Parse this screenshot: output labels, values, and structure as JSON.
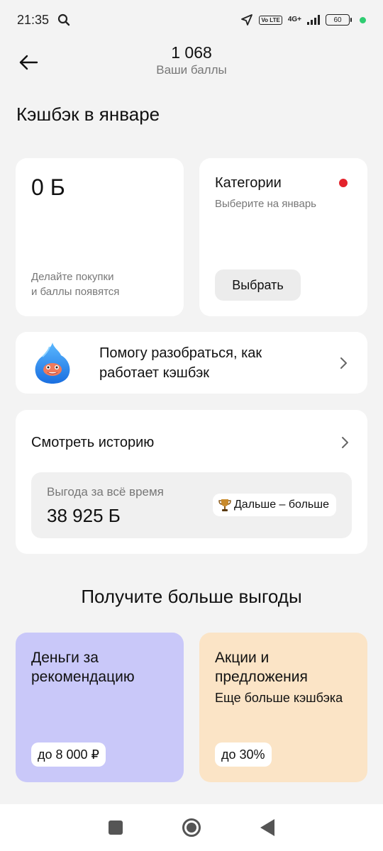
{
  "status_bar": {
    "time": "21:35",
    "volte": "Vo LTE",
    "network": "4G+",
    "battery": "60",
    "icons": [
      "search-icon",
      "location-arrow-icon",
      "signal-icon",
      "battery-icon"
    ]
  },
  "header": {
    "points_value": "1 068",
    "points_label": "Ваши баллы",
    "back_icon": "arrow-left-icon"
  },
  "cashback": {
    "section_title": "Кэшбэк в январе",
    "balance_value": "0 Б",
    "balance_hint_line1": "Делайте покупки",
    "balance_hint_line2": "и баллы появятся"
  },
  "categories": {
    "title": "Категории",
    "subtitle": "Выберите на январь",
    "button_label": "Выбрать",
    "indicator_color": "#e3232c"
  },
  "help": {
    "text_line1": "Помогу разобраться, как",
    "text_line2": "работает кэшбэк",
    "mascot_icon": "mascot-icon"
  },
  "history": {
    "title": "Смотреть историю",
    "benefit_label": "Выгода за всё время",
    "benefit_value": "38 925 Б",
    "badge_label": "Дальше – больше",
    "badge_icon": "trophy-icon"
  },
  "more": {
    "title": "Получите больше выгоды"
  },
  "promos": [
    {
      "title_line1": "Деньги за",
      "title_line2": "рекомендацию",
      "badge": "до 8 000 ₽",
      "color": "#c9c8f9"
    },
    {
      "title_line1": "Акции и",
      "title_line2": "предложения",
      "subtitle": "Еще больше кэшбэка",
      "badge": "до 30%",
      "color": "#fbe4c6"
    }
  ],
  "navbar": {
    "icons": [
      "recents-icon",
      "home-icon",
      "back-icon"
    ]
  }
}
